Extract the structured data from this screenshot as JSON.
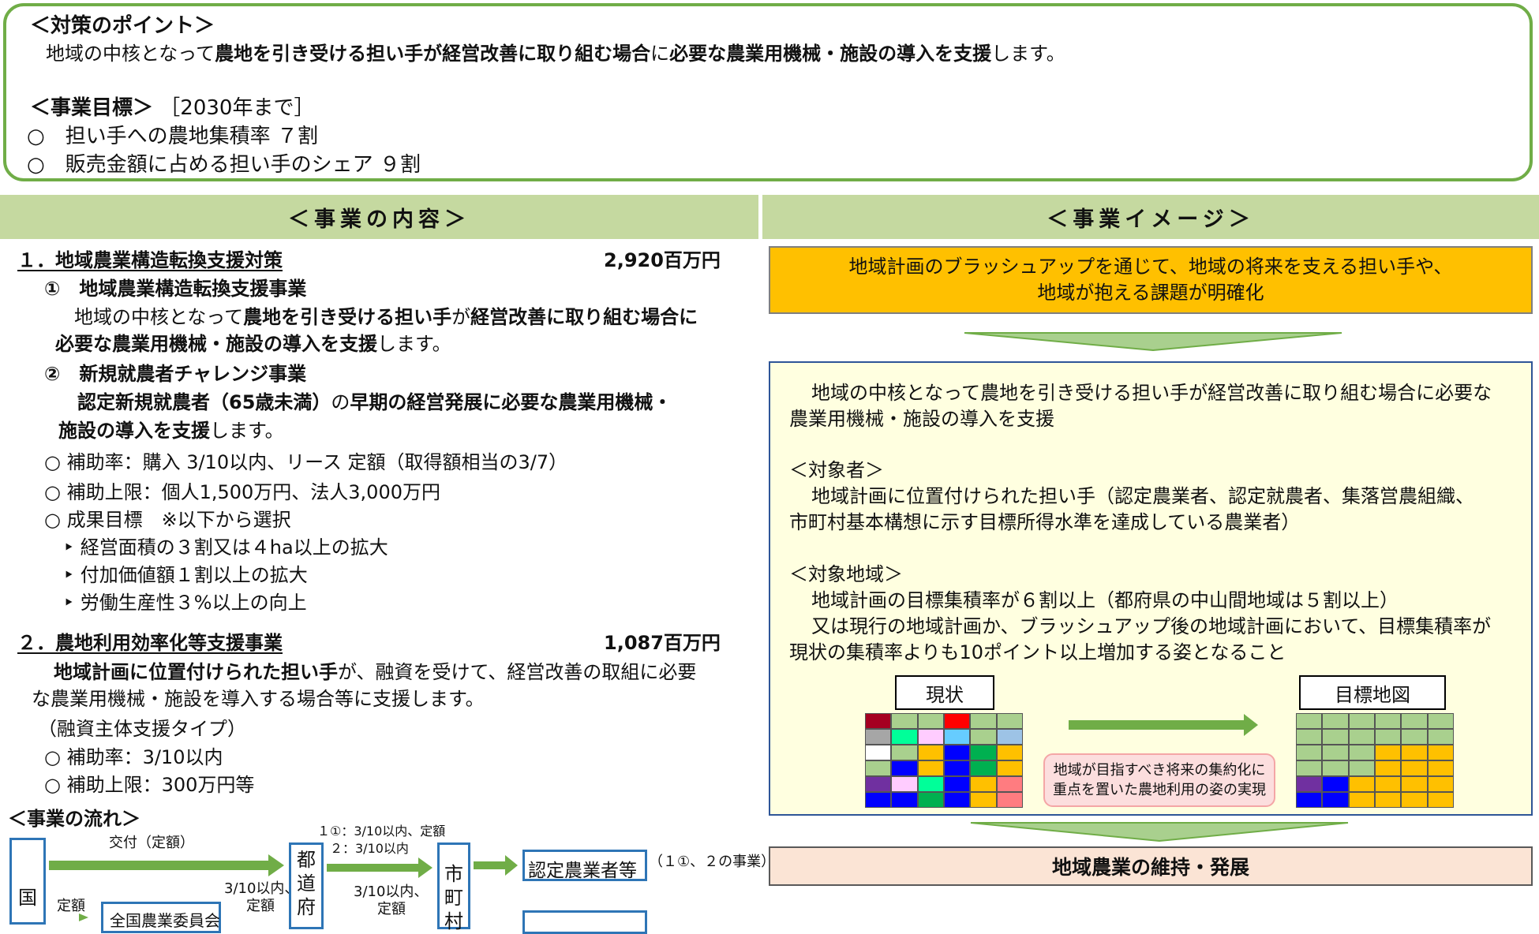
{
  "points": {
    "heading": "＜対策のポイント＞",
    "line_pre": "地域の中核となって",
    "line_b1": "農地を引き受ける担い手が経営改善に取り組む場合",
    "line_mid": "に",
    "line_b2": "必要な農業用機械・施設の導入を支援",
    "line_post": "します。",
    "goals_heading": "＜事業目標＞",
    "goals_period": "［2030年まで］",
    "goals": [
      "○　担い手への農地集積率 ７割",
      "○　販売金額に占める担い手のシェア ９割"
    ]
  },
  "headers": {
    "left": "＜事業の内容＞",
    "right": "＜事業イメージ＞"
  },
  "content": {
    "s1_title": "１．地域農業構造転換支援対策",
    "s1_amount": "2,920百万円",
    "s1_sub1_title": "①　地域農業構造転換支援事業",
    "s1_sub1_pre": "地域の中核となって",
    "s1_sub1_b1": "農地を引き受ける担い手",
    "s1_sub1_mid": "が",
    "s1_sub1_b2": "経営改善に取り組む場合に",
    "s1_sub1_b3": "必要な農業用機械・施設の導入を支援",
    "s1_sub1_post": "します。",
    "s1_sub2_title": "②　新規就農者チャレンジ事業",
    "s1_sub2_b1": "認定新規就農者（65歳未満）",
    "s1_sub2_mid": "の",
    "s1_sub2_b2": "早期の経営発展に必要な農業用機械・",
    "s1_sub2_b3": "施設の導入を支援",
    "s1_sub2_post": "します。",
    "s1_bullets": [
      "○ 補助率：購入 3/10以内、リース 定額（取得額相当の3/7）",
      "○ 補助上限：個人1,500万円、法人3,000万円",
      "○ 成果目標　※以下から選択"
    ],
    "s1_targets": [
      "‣ 経営面積の３割又は４ha以上の拡大",
      "‣ 付加価値額１割以上の拡大",
      "‣ 労働生産性３%以上の向上"
    ],
    "s2_title": "２．農地利用効率化等支援事業",
    "s2_amount": "1,087百万円",
    "s2_b1": "地域計画に位置付けられた担い手",
    "s2_l1_post": "が、融資を受けて、経営改善の取組に必要",
    "s2_l2": "な農業用機械・施設を導入する場合等に支援します。",
    "s2_type": "（融資主体支援タイプ）",
    "s2_bullets": [
      "○ 補助率：3/10以内",
      "○ 補助上限：300万円等"
    ]
  },
  "flow": {
    "heading": "＜事業の流れ＞",
    "kuni": "国",
    "kofu": "交付（定額）",
    "teigaku": "定額",
    "zenkoku": "全国農業委員会",
    "mid_rate1": "3/10以内、",
    "mid_rate2": "定額",
    "pref": [
      "都",
      "道",
      "府"
    ],
    "top_rate1": "１①：3/10以内、定額",
    "top_rate2": "２：3/10以内",
    "city_rate1": "3/10以内、",
    "city_rate2": "定額",
    "city": [
      "市",
      "町",
      "村"
    ],
    "nintei": "認定農業者等",
    "nintei_note": "（１①、２の事業）"
  },
  "image": {
    "banner_l1": "地域計画のブラッシュアップを通じて、地域の将来を支える担い手や、",
    "banner_l2": "地域が抱える課題が明確化",
    "desc_l1": "地域の中核となって農地を引き受ける担い手が経営改善に取り組む場合に必要な",
    "desc_l2": "農業用機械・施設の導入を支援",
    "target_heading": "＜対象者＞",
    "target_l1": "地域計画に位置付けられた担い手（認定農業者、認定就農者、集落営農組織、",
    "target_l2": "市町村基本構想に示す目標所得水準を達成している農業者）",
    "area_heading": "＜対象地域＞",
    "area_l1": "地域計画の目標集積率が６割以上（都府県の中山間地域は５割以上）",
    "area_l2": "又は現行の地域計画か、ブラッシュアップ後の地域計画において、目標集積率が",
    "area_l3": "現状の集積率よりも10ポイント以上増加する姿となること",
    "current_label": "現状",
    "target_label": "目標地図",
    "note_l1": "地域が目指すべき将来の集約化に",
    "note_l2": "重点を置いた農地利用の姿の実現",
    "result": "地域農業の維持・発展"
  },
  "grid_current": [
    [
      "#a50021",
      "#a9d08e",
      "#a9d08e",
      "#ff0000",
      "#a9d08e",
      "#a9d08e"
    ],
    [
      "#a6a6a6",
      "#00ff99",
      "#ffccff",
      "#66ccff",
      "#a9d08e",
      "#9dc3e6"
    ],
    [
      "#ffffff",
      "#a9d08e",
      "#ffc000",
      "#0000ff",
      "#00b050",
      "#ffc000"
    ],
    [
      "#a9d08e",
      "#0000ff",
      "#ffc000",
      "#0000ff",
      "#00b050",
      "#ffc000"
    ],
    [
      "#7030a0",
      "#ffccff",
      "#00ff99",
      "#0000ff",
      "#ffc000",
      "#ff7c80"
    ],
    [
      "#0000ff",
      "#0000ff",
      "#00b050",
      "#0000ff",
      "#ffc000",
      "#ff7c80"
    ]
  ],
  "grid_target": [
    [
      "#a9d08e",
      "#a9d08e",
      "#a9d08e",
      "#a9d08e",
      "#a9d08e",
      "#a9d08e"
    ],
    [
      "#a9d08e",
      "#a9d08e",
      "#a9d08e",
      "#a9d08e",
      "#a9d08e",
      "#a9d08e"
    ],
    [
      "#a9d08e",
      "#a9d08e",
      "#a9d08e",
      "#ffc000",
      "#ffc000",
      "#ffc000"
    ],
    [
      "#a9d08e",
      "#a9d08e",
      "#a9d08e",
      "#ffc000",
      "#ffc000",
      "#ffc000"
    ],
    [
      "#7030a0",
      "#0000ff",
      "#ffc000",
      "#ffc000",
      "#ffc000",
      "#ffc000"
    ],
    [
      "#0000ff",
      "#0000ff",
      "#ffc000",
      "#ffc000",
      "#ffc000",
      "#ffc000"
    ]
  ]
}
